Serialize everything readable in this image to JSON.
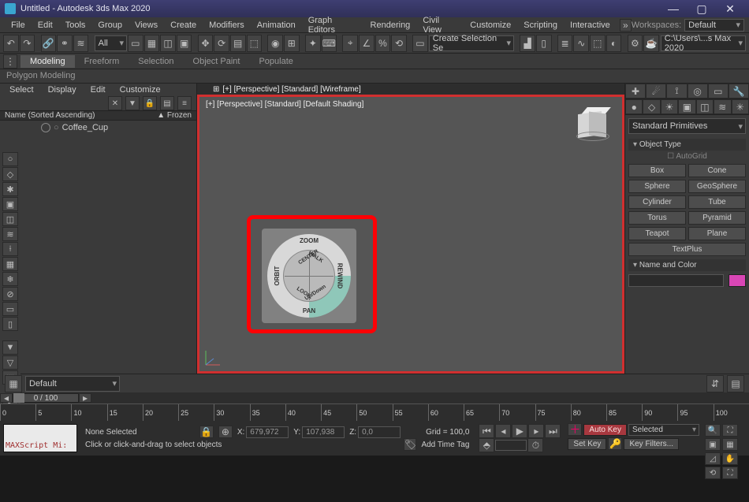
{
  "window": {
    "title": "Untitled - Autodesk 3ds Max 2020"
  },
  "menus": [
    "File",
    "Edit",
    "Tools",
    "Group",
    "Views",
    "Create",
    "Modifiers",
    "Animation",
    "Graph Editors",
    "Rendering",
    "Civil View",
    "Customize",
    "Scripting",
    "Interactive"
  ],
  "workspace": {
    "label": "Workspaces:",
    "value": "Default"
  },
  "toolbar": {
    "all": "All",
    "selset": "Create Selection Se",
    "path": "C:\\Users\\...s Max 2020"
  },
  "ribbon": {
    "tabs": [
      "Modeling",
      "Freeform",
      "Selection",
      "Object Paint",
      "Populate"
    ],
    "sub": "Polygon Modeling"
  },
  "scene": {
    "menus": [
      "Select",
      "Display",
      "Edit",
      "Customize"
    ],
    "header": {
      "name": "Name (Sorted Ascending)",
      "frozen": "▲   Frozen"
    },
    "item": "Coffee_Cup",
    "footer": "Default"
  },
  "viewport": {
    "label": "[+] [Perspective] [Standard] [Wireframe]",
    "label2": "[+] [Perspective] [Standard] [Default Shading]",
    "wheel": {
      "top": "ZOOM",
      "bottom": "PAN",
      "left": "ORBIT",
      "right": "REWIND",
      "i1": "CENTER",
      "i2": "WALK",
      "i3": "LOOK",
      "i4": "Up/Down"
    }
  },
  "right": {
    "dd": "Standard Primitives",
    "obj_title": "Object Type",
    "autogrid": "AutoGrid",
    "buttons": [
      "Box",
      "Cone",
      "Sphere",
      "GeoSphere",
      "Cylinder",
      "Tube",
      "Torus",
      "Pyramid",
      "Teapot",
      "Plane",
      "TextPlus"
    ],
    "nc_title": "Name and Color"
  },
  "timeline": {
    "slider": "0 / 100",
    "ticks": [
      "0",
      "5",
      "10",
      "15",
      "20",
      "25",
      "30",
      "35",
      "40",
      "45",
      "50",
      "55",
      "60",
      "65",
      "70",
      "75",
      "80",
      "85",
      "90",
      "95",
      "100"
    ]
  },
  "status": {
    "maxscript": "MAXScript Mi:",
    "sel": "None Selected",
    "hint": "Click or click-and-drag to select objects",
    "x": "X:",
    "xv": "679,972",
    "y": "Y:",
    "yv": "107,938",
    "z": "Z:",
    "zv": "0,0",
    "grid": "Grid = 100,0",
    "timetag": "Add Time Tag",
    "autokey": "Auto Key",
    "setkey": "Set Key",
    "filters": "Selected",
    "keyfilters": "Key Filters..."
  }
}
